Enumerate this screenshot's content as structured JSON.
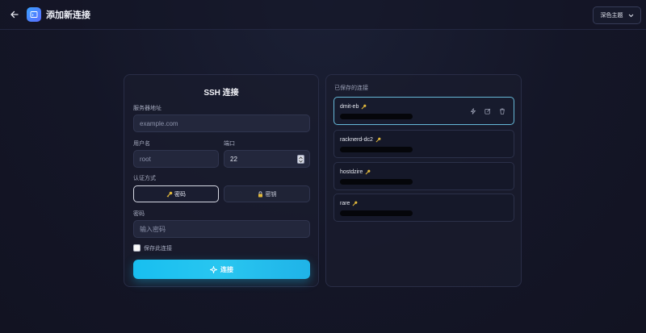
{
  "header": {
    "title": "添加新连接",
    "theme_select": "深色主题"
  },
  "form": {
    "title": "SSH 连接",
    "server_label": "服务器地址",
    "server_placeholder": "example.com",
    "username_label": "用户名",
    "username_placeholder": "root",
    "port_label": "端口",
    "port_value": "22",
    "auth_label": "认证方式",
    "auth_options": [
      "密码",
      "密钥"
    ],
    "auth_selected": "密码",
    "password_label": "密码",
    "password_placeholder": "输入密码",
    "save_label": "保存此连接",
    "save_checked": false,
    "connect_label": "连接"
  },
  "saved": {
    "title": "已保存的连接",
    "items": [
      {
        "name": "dmit-eb"
      },
      {
        "name": "racknerd-dc2"
      },
      {
        "name": "hostdzire"
      },
      {
        "name": "rare"
      }
    ],
    "active_index": 0
  },
  "icons": {
    "back": "arrow-left-icon",
    "app": "terminal-window-icon",
    "theme_chevron": "chevron-down-icon",
    "password_auth": "key-icon",
    "key_auth": "lock-key-icon",
    "connect": "sparkle-icon",
    "saved_item": "key-icon",
    "quick_connect": "lightning-icon",
    "edit": "edit-icon",
    "delete": "trash-icon"
  },
  "colors": {
    "accent": "#1ec0ef",
    "active_border": "#66b8d8",
    "key_icon": "#e2b93b"
  }
}
